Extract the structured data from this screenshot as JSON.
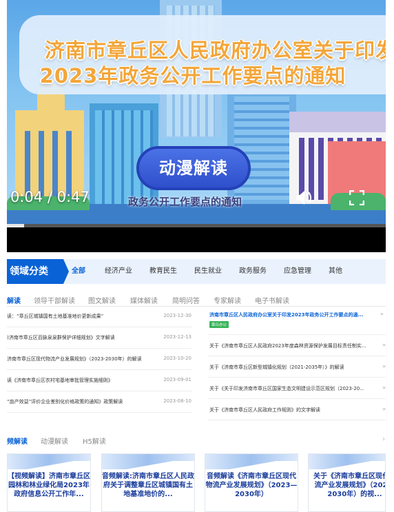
{
  "video": {
    "title_line1": "济南市章丘区人民政府办公室关于印发",
    "title_line2": "2023年政务公开工作要点的通知",
    "button": "动漫解读",
    "subtitle": "政务公开工作要点的通知",
    "time": "0:04 / 0:47",
    "progress": 0.045
  },
  "category": {
    "title": "领域分类",
    "items": [
      "全部",
      "经济产业",
      "教育民生",
      "民生就业",
      "政务服务",
      "应急管理",
      "其他"
    ],
    "active": "全部"
  },
  "interp_tabs": [
    "解读",
    "领导干部解读",
    "图文解读",
    "媒体解读",
    "简明问答",
    "专家解读",
    "电子书解读"
  ],
  "left_list": [
    {
      "title": "读：“章丘区城镇国有土地基准地价更新成果”",
      "date": "2023-12-30"
    },
    {
      "title": ")济南市章丘区百脉泉泉群保护详细规划》文字解读",
      "date": "2023-12-13"
    },
    {
      "title": "济南市章丘区现代物流产业发展规划》（2023-2030年）的解读",
      "date": "2023-10-20"
    },
    {
      "title": "读《济南市章丘区农村宅基地审批管理实施细则》",
      "date": "2023-09-01"
    },
    {
      "title": "“亩产效益”评价企业差别化价格政策的通知》政策解读",
      "date": "2023-08-10"
    }
  ],
  "right_featured": {
    "title": "济南市章丘区人民政府办公室关于印发2023年政务公开工作要点的通...",
    "badge": "章丘办公"
  },
  "right_list": [
    "关于《济南市章丘区人民政府2023年度森林资源保护发展目标责任制实...",
    "关于《济南市章丘区新型城镇化规划（2021-2035年）》的解读",
    "关于《关于印发济南市章丘区国家生态文明建设示范区规划（2023-20...",
    "关于《济南市章丘区人民政府工作规则》的文字解读"
  ],
  "media_tabs": [
    "频解读",
    "动漫解读",
    "H5解读"
  ],
  "cards": [
    "【视频解读】济南市章丘区园林和林业绿化局2023年政府信息公开工作年...",
    "音频解读:济南市章丘区人民政府关于调整章丘区城镇国有土地基准地价的...",
    "音频解读《济南市章丘区现代物流产业发展规划》（2023—2030年）",
    "关于《济南市章丘区现代物流产业发展规划》（2023-2030年）的视..."
  ]
}
